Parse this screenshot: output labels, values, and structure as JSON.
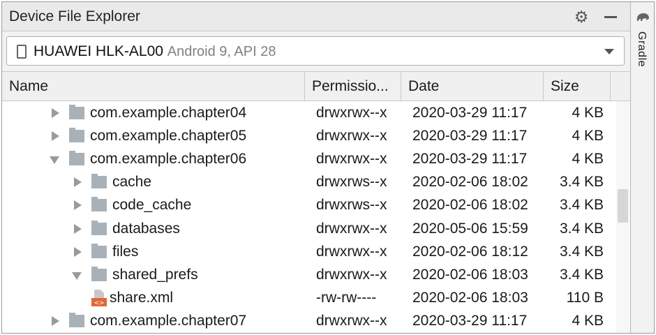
{
  "window": {
    "title": "Device File Explorer",
    "side_tab": "Gradle"
  },
  "device": {
    "name": "HUAWEI HLK-AL00",
    "version": "Android 9, API 28"
  },
  "columns": {
    "name": "Name",
    "permissions": "Permissio...",
    "date": "Date",
    "size": "Size"
  },
  "rows": [
    {
      "name": "com.example.chapter04",
      "permissions": "drwxrwx--x",
      "date": "2020-03-29 11:17",
      "size": "4 KB",
      "depth": 0,
      "type": "folder",
      "expanded": false
    },
    {
      "name": "com.example.chapter05",
      "permissions": "drwxrwx--x",
      "date": "2020-03-29 11:17",
      "size": "4 KB",
      "depth": 0,
      "type": "folder",
      "expanded": false
    },
    {
      "name": "com.example.chapter06",
      "permissions": "drwxrwx--x",
      "date": "2020-03-29 11:17",
      "size": "4 KB",
      "depth": 0,
      "type": "folder",
      "expanded": true
    },
    {
      "name": "cache",
      "permissions": "drwxrws--x",
      "date": "2020-02-06 18:02",
      "size": "3.4 KB",
      "depth": 1,
      "type": "folder",
      "expanded": false
    },
    {
      "name": "code_cache",
      "permissions": "drwxrws--x",
      "date": "2020-02-06 18:02",
      "size": "3.4 KB",
      "depth": 1,
      "type": "folder",
      "expanded": false
    },
    {
      "name": "databases",
      "permissions": "drwxrwx--x",
      "date": "2020-05-06 15:59",
      "size": "3.4 KB",
      "depth": 1,
      "type": "folder",
      "expanded": false
    },
    {
      "name": "files",
      "permissions": "drwxrwx--x",
      "date": "2020-02-06 18:12",
      "size": "3.4 KB",
      "depth": 1,
      "type": "folder",
      "expanded": false
    },
    {
      "name": "shared_prefs",
      "permissions": "drwxrwx--x",
      "date": "2020-02-06 18:03",
      "size": "3.4 KB",
      "depth": 1,
      "type": "folder",
      "expanded": true
    },
    {
      "name": "share.xml",
      "permissions": "-rw-rw----",
      "date": "2020-02-06 18:03",
      "size": "110 B",
      "depth": 2,
      "type": "xml-file",
      "expanded": false
    },
    {
      "name": "com.example.chapter07",
      "permissions": "drwxrwx--x",
      "date": "2020-03-29 11:17",
      "size": "4 KB",
      "depth": 0,
      "type": "folder",
      "expanded": false
    }
  ],
  "icons": {
    "settings": "gear-icon",
    "minimize": "minimize-icon",
    "device": "phone-icon",
    "dropdown": "chevron-down-icon",
    "folder": "folder-icon",
    "xml_file": "xml-file-icon",
    "gradle": "elephant-icon"
  },
  "colors": {
    "folder": "#a9b1b8",
    "xml_badge": "#e0683a",
    "muted_text": "#808080"
  }
}
